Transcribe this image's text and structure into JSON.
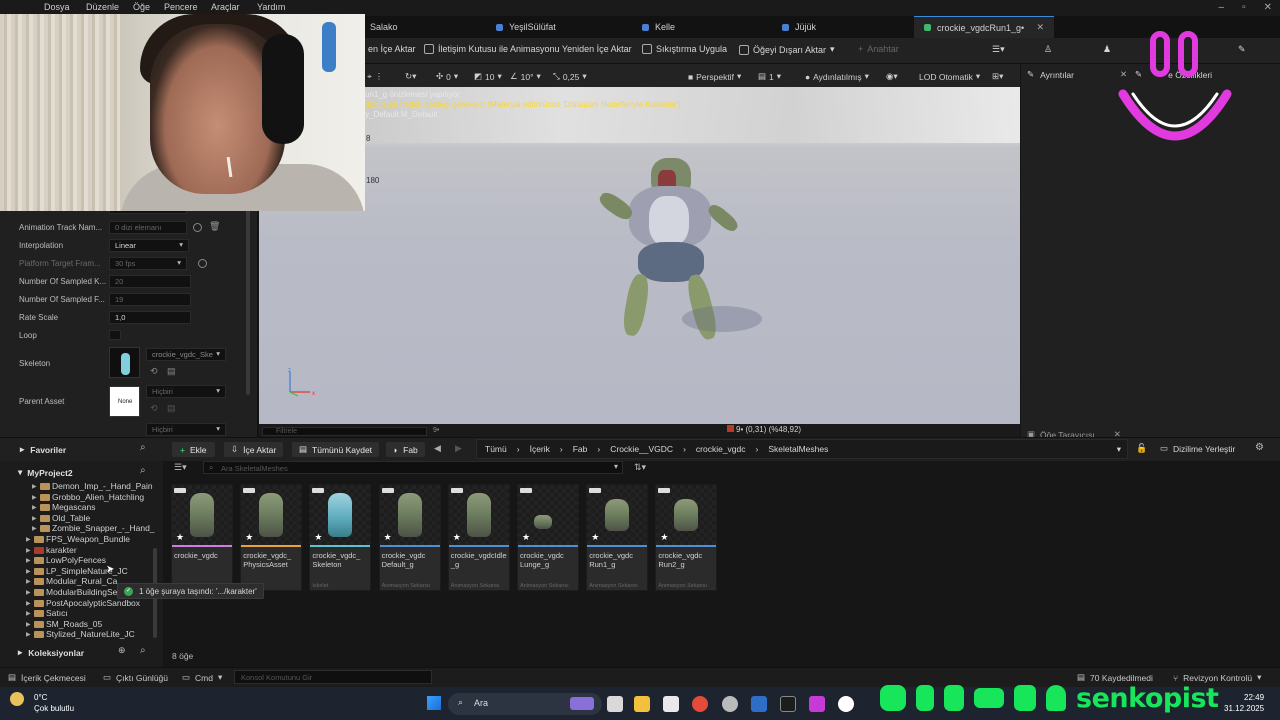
{
  "menu": [
    "Dosya",
    "Düzenle",
    "Öğe",
    "Pencere",
    "Araçlar",
    "Yardım"
  ],
  "tabs": [
    {
      "label": "Salako"
    },
    {
      "label": "YeşilSülüfat"
    },
    {
      "label": "Kelle"
    },
    {
      "label": "Jüjük"
    },
    {
      "label": "crockie_vgdcRun1_g•",
      "active": true
    }
  ],
  "toolbar": {
    "import_partial": "en İçe Aktar",
    "reimport_dialog": "İletişim Kutusu ile Animasyonu Yeniden İçe Aktar",
    "compression": "Sıkıştırma Uygula",
    "export": "Öğeyi Dışarı Aktar",
    "keys": "Anahtar"
  },
  "details": {
    "props": [
      {
        "label": "Animation Track Nam...",
        "value": "0 dizi elemanı",
        "dim": true
      },
      {
        "label": "Interpolation",
        "value": "Linear",
        "dropdown": true
      },
      {
        "label": "Platform Target Fram...",
        "value": "30 fps",
        "dropdown": true,
        "dim": true
      },
      {
        "label": "Number Of Sampled K...",
        "value": "20",
        "dim": true
      },
      {
        "label": "Number Of Sampled F...",
        "value": "19",
        "dim": true
      },
      {
        "label": "Rate Scale",
        "value": "1,0"
      },
      {
        "label": "Loop",
        "value": ""
      }
    ],
    "skeleton_label": "Skeleton",
    "skeleton_value": "crockie_vgdc_Ske",
    "parent_label": "Parent Asset",
    "parent_value": "Hiçbiri",
    "parent_thumb": "None",
    "lower_value": "Hiçbiri"
  },
  "viewport": {
    "zero": "0",
    "ten": "10",
    "angle": "10°",
    "scale": "0,25",
    "perspective": "Perspektif",
    "count": "1",
    "lit": "Aydınlatılmış",
    "lod": "LOD Otomatik",
    "side_180": "180",
    "side_b": "8",
    "warn_line1": "un1_g önizlemesi yapılıyor",
    "warn_line2": "dönüşüm hedefi desteği gerekiyor (Materyal editöründe 'Dönüşüm Hedefleriyle Kullanılır').",
    "warn_line3": "y_Default.M_Default",
    "status_readout": "9• (0,31) (%48,92)",
    "filter_placeholder": "Filtrele",
    "filter_count": "9•"
  },
  "right": {
    "details_tab": "Ayrıntılar",
    "asset_tab": "e Özellikleri",
    "asset_browser": "Öğe Tarayıcısı"
  },
  "content_browser": {
    "favorites": "Favoriler",
    "add": "Ekle",
    "import": "İçe Aktar",
    "save_all": "Tümünü Kaydet",
    "fab": "Fab",
    "breadcrumb": [
      "Tümü",
      "İçerik",
      "Fab",
      "Crockie__VGDC",
      "crockie_vgdc",
      "SkeletalMeshes"
    ],
    "search_placeholder": "Ara SkeletalMeshes",
    "dock": "Dizilime Yerleştir",
    "project": "MyProject2",
    "tree": [
      {
        "label": "Demon_Imp_-_Hand_Pain",
        "indent": 1
      },
      {
        "label": "Grobbo_Alien_Hatchling",
        "indent": 1
      },
      {
        "label": "Megascans",
        "indent": 1
      },
      {
        "label": "Old_Table",
        "indent": 1
      },
      {
        "label": "Zombie_Snapper_-_Hand_",
        "indent": 1
      },
      {
        "label": "FPS_Weapon_Bundle",
        "indent": 0
      },
      {
        "label": "karakter",
        "indent": 0,
        "red": true
      },
      {
        "label": "LowPolyFences",
        "indent": 0
      },
      {
        "label": "LP_SimpleNature_JC",
        "indent": 0
      },
      {
        "label": "Modular_Rural_Ca",
        "indent": 0
      },
      {
        "label": "ModularBuildingSe",
        "indent": 0
      },
      {
        "label": "PostApocalypticSandbox",
        "indent": 0
      },
      {
        "label": "Satıcı",
        "indent": 0
      },
      {
        "label": "SM_Roads_05",
        "indent": 0
      },
      {
        "label": "Stylized_NatureLite_JC",
        "indent": 0
      }
    ],
    "collections": "Koleksiyonlar",
    "count": "8 öğe",
    "toast": "1 öğe şuraya taşındı: '.../karakter'",
    "assets": [
      {
        "name": "crockie_vgdc",
        "type": "",
        "color": "#d07be0"
      },
      {
        "name": "crockie_vgdc_ PhysicsAsset",
        "type": "",
        "color": "#e8a23a"
      },
      {
        "name": "crockie_vgdc_ Skeleton",
        "type": "İskelet",
        "color": "#5ec2d6"
      },
      {
        "name": "crockie_vgdc Default_g",
        "type": "Animasyon Sekansı",
        "color": "#4d8fd9"
      },
      {
        "name": "crockie_vgdcIdle _g",
        "type": "Animasyon Sekansı",
        "color": "#4d8fd9"
      },
      {
        "name": "crockie_vgdc Lunge_g",
        "type": "Animasyon Sekansı",
        "color": "#4d8fd9"
      },
      {
        "name": "crockie_vgdc Run1_g",
        "type": "Animasyon Sekansı",
        "color": "#4d8fd9"
      },
      {
        "name": "crockie_vgdc Run2_g",
        "type": "Animasyon Sekansı",
        "color": "#4d8fd9"
      }
    ]
  },
  "statusbar": {
    "drawer": "İçerik Çekmecesi",
    "log": "Çıktı Günlüğü",
    "cmd": "Cmd",
    "console_placeholder": "Konsol Komutunu Gir",
    "saved": "70 Kaydedilmedi",
    "revision": "Revizyon Kontrolü"
  },
  "taskbar": {
    "temp": "0°C",
    "weather": "Çok bulutlu",
    "search": "Ara",
    "time": "22:49",
    "date": "31.12.2025"
  },
  "overlay": {
    "brand": "senkopist",
    "brand_color": "#17e55a",
    "logo_color": "#e13be0"
  }
}
